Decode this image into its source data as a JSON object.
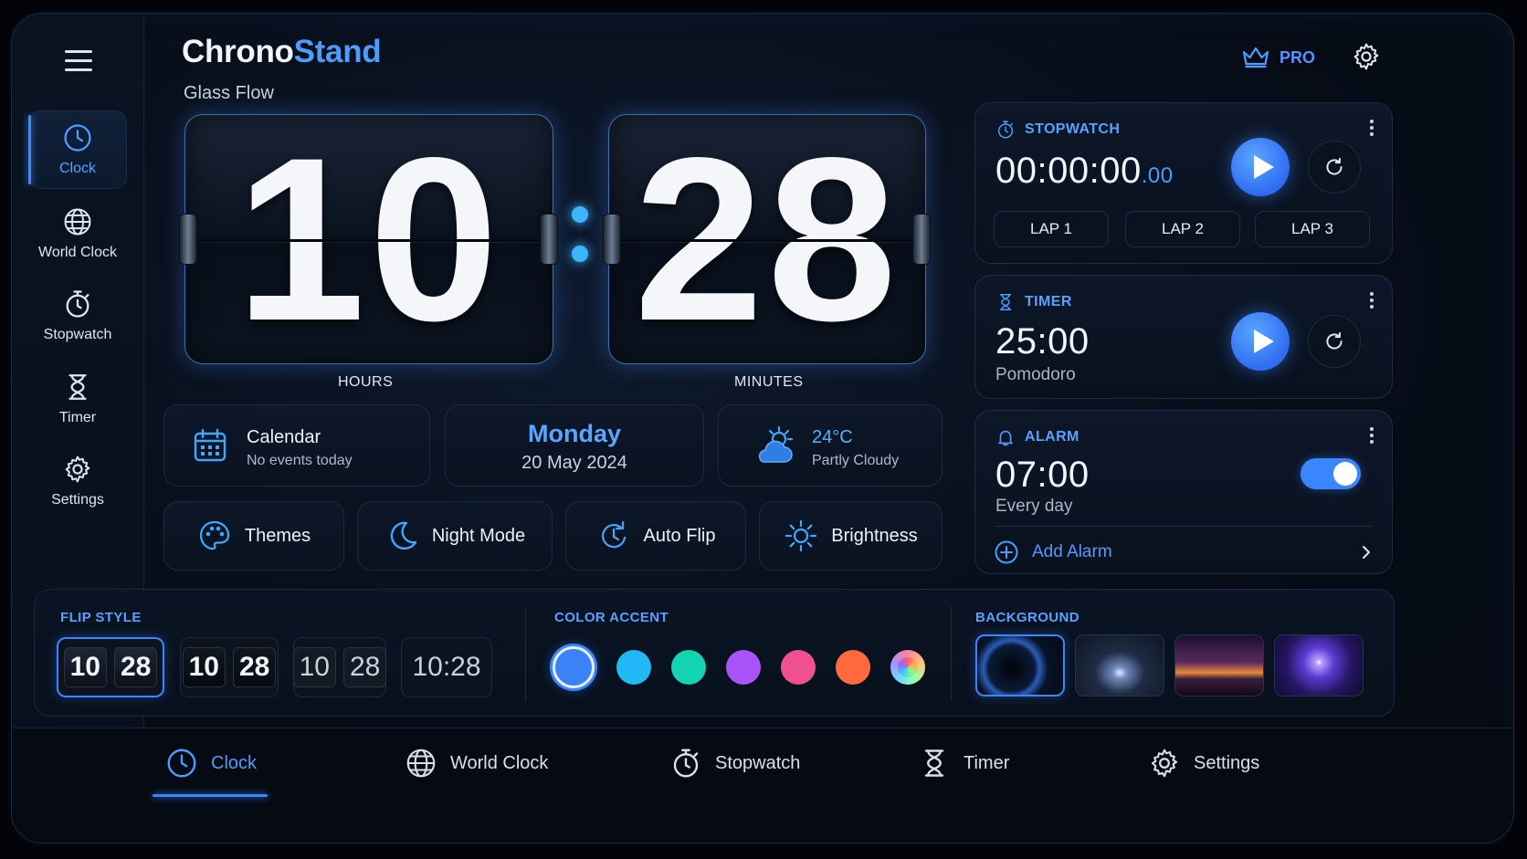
{
  "app": {
    "brand_part1": "Chrono",
    "brand_part2": "Stand",
    "subtitle": "Glass Flow"
  },
  "header": {
    "pro_label": "PRO",
    "icons": [
      "crown-icon",
      "gear-icon"
    ]
  },
  "sidebar": {
    "items": [
      {
        "label": "Clock",
        "icon": "clock-icon",
        "active": true
      },
      {
        "label": "World Clock",
        "icon": "globe-icon"
      },
      {
        "label": "Stopwatch",
        "icon": "stopwatch-icon"
      },
      {
        "label": "Timer",
        "icon": "hourglass-icon"
      },
      {
        "label": "Settings",
        "icon": "gear-icon"
      }
    ]
  },
  "clock": {
    "hours": "10",
    "minutes": "28",
    "hours_label": "HOURS",
    "minutes_label": "MINUTES"
  },
  "info": {
    "calendar_title": "Calendar",
    "calendar_sub": "No events today",
    "day": "Monday",
    "date": "20 May 2024",
    "temperature": "24°C",
    "weather": "Partly Cloudy"
  },
  "quick_actions": [
    {
      "label": "Themes",
      "icon": "palette-icon"
    },
    {
      "label": "Night Mode",
      "icon": "moon-icon"
    },
    {
      "label": "Auto Flip",
      "icon": "auto-flip-icon"
    },
    {
      "label": "Brightness",
      "icon": "sun-icon"
    }
  ],
  "stopwatch": {
    "title": "STOPWATCH",
    "time": "00:00:00",
    "ms": ".00",
    "laps": [
      "LAP 1",
      "LAP 2",
      "LAP 3"
    ]
  },
  "timer": {
    "title": "TIMER",
    "time": "25:00",
    "label": "Pomodoro"
  },
  "alarm": {
    "title": "ALARM",
    "time": "07:00",
    "repeat": "Every day",
    "enabled": true,
    "add_label": "Add Alarm"
  },
  "customize": {
    "flip_style_label": "FLIP STYLE",
    "flip_styles": [
      {
        "h": "10",
        "m": "28",
        "selected": true
      },
      {
        "h": "10",
        "m": "28"
      },
      {
        "h": "10",
        "m": "28"
      },
      {
        "text": "10:28"
      }
    ],
    "color_label": "COLOR ACCENT",
    "colors": [
      "#3b82f6",
      "#22b8f5",
      "#14d3b0",
      "#a855f7",
      "#f0508f",
      "#ff6a3d",
      "rainbow"
    ],
    "selected_color": "#3b82f6",
    "background_label": "BACKGROUND",
    "background_selected": 0
  },
  "bottom_nav": [
    {
      "label": "Clock",
      "icon": "clock-icon",
      "active": true
    },
    {
      "label": "World Clock",
      "icon": "globe-icon"
    },
    {
      "label": "Stopwatch",
      "icon": "stopwatch-icon"
    },
    {
      "label": "Timer",
      "icon": "hourglass-icon"
    },
    {
      "label": "Settings",
      "icon": "gear-icon"
    }
  ]
}
